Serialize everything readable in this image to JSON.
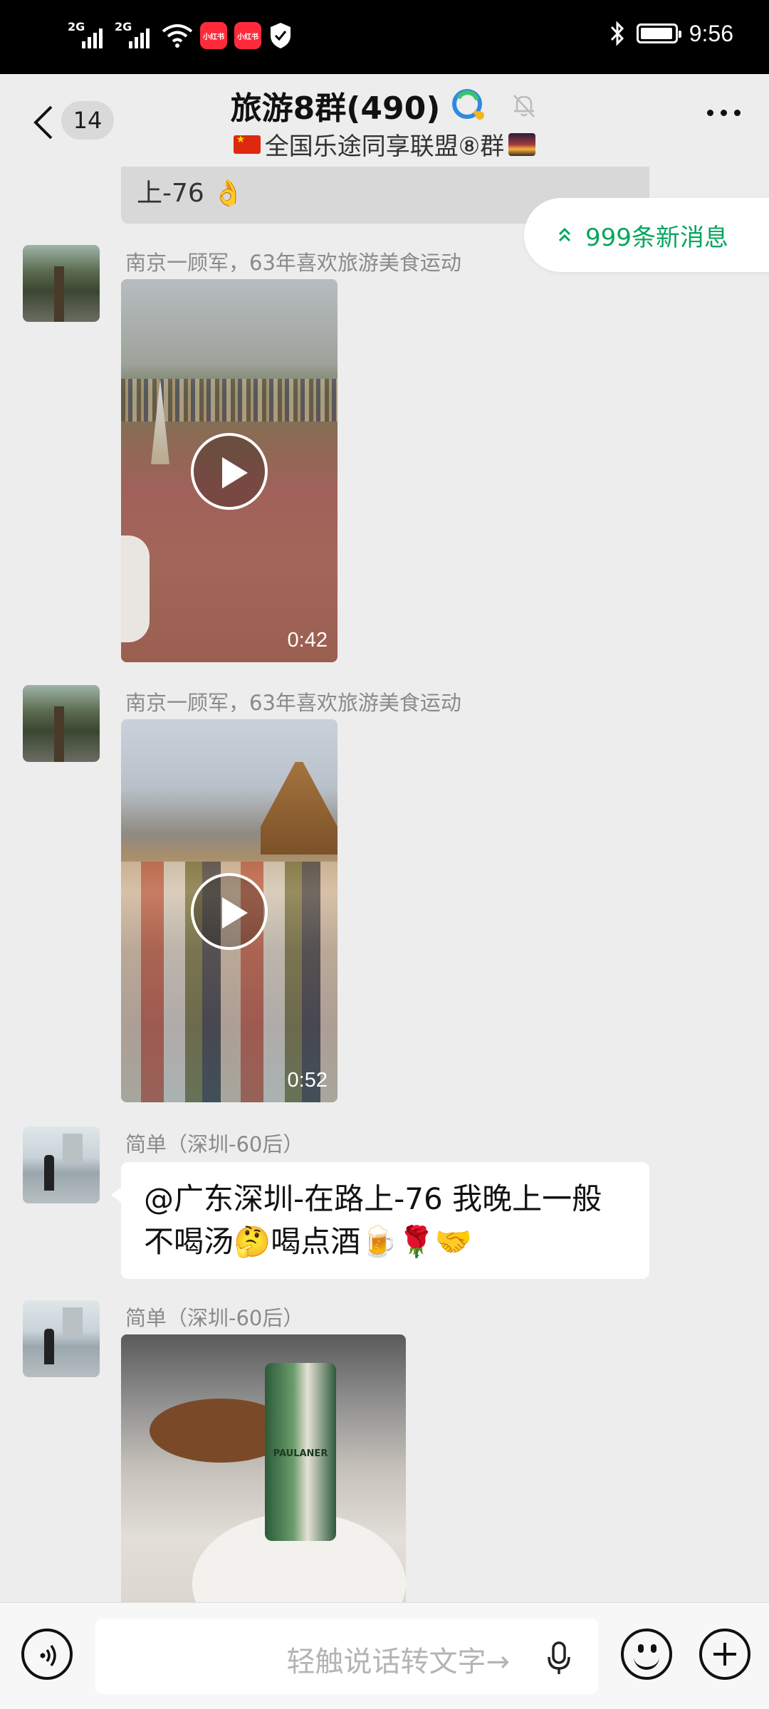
{
  "status_bar": {
    "sim1": "2G",
    "sim2": "2G",
    "app_badges": [
      "小红书",
      "小红书"
    ],
    "time": "9:56"
  },
  "header": {
    "unread_count": "14",
    "title": "旅游8群(490)",
    "subtitle": "全国乐途同享联盟⑧群"
  },
  "chat": {
    "prev_bubble_tail": "上-76 👌",
    "new_messages": "999条新消息",
    "messages": [
      {
        "sender": "南京一顾军，63年喜欢旅游美食运动",
        "type": "video",
        "duration": "0:42"
      },
      {
        "sender": "南京一顾军，63年喜欢旅游美食运动",
        "type": "video",
        "duration": "0:52"
      },
      {
        "sender": "简单（深圳-60后）",
        "type": "text",
        "text": "@广东深圳-在路上-76  我晚上一般不喝汤🤔喝点酒🍺🌹🤝"
      },
      {
        "sender": "简单（深圳-60后）",
        "type": "image"
      }
    ]
  },
  "input": {
    "placeholder": "轻触说话转文字→"
  }
}
